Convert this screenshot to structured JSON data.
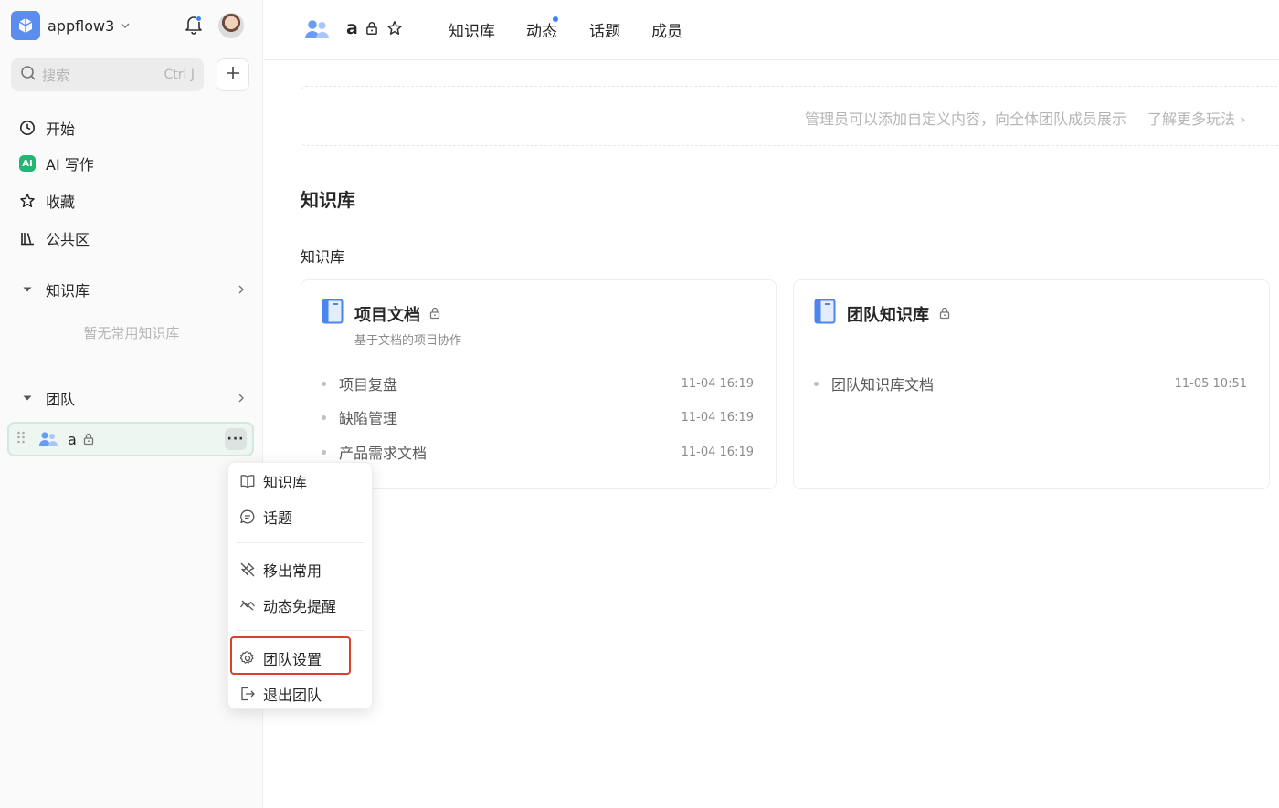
{
  "workspace": {
    "name": "appflow3"
  },
  "search": {
    "placeholder": "搜索",
    "shortcut": "Ctrl J"
  },
  "sidebar": {
    "nav": [
      {
        "label": "开始",
        "icon": "clock-icon"
      },
      {
        "label": "AI 写作",
        "icon": "ai-icon",
        "badge": "AI"
      },
      {
        "label": "收藏",
        "icon": "star-icon"
      },
      {
        "label": "公共区",
        "icon": "library-icon"
      }
    ],
    "knowledge_section": {
      "label": "知识库",
      "empty_text": "暂无常用知识库"
    },
    "team_section": {
      "label": "团队"
    },
    "team_item": {
      "name": "a",
      "more": "···"
    }
  },
  "context_menu": {
    "items": [
      {
        "label": "知识库",
        "icon": "book-icon"
      },
      {
        "label": "话题",
        "icon": "chat-icon"
      },
      {
        "label": "移出常用",
        "icon": "unpin-icon"
      },
      {
        "label": "动态免提醒",
        "icon": "mute-icon"
      },
      {
        "label": "团队设置",
        "icon": "gear-icon",
        "highlighted": true
      },
      {
        "label": "退出团队",
        "icon": "exit-icon"
      }
    ]
  },
  "header": {
    "team_name": "a",
    "tabs": [
      {
        "label": "知识库"
      },
      {
        "label": "动态",
        "has_dot": true
      },
      {
        "label": "话题"
      },
      {
        "label": "成员"
      }
    ]
  },
  "banner": {
    "text": "管理员可以添加自定义内容，向全体团队成员展示",
    "link": "了解更多玩法 ›"
  },
  "main": {
    "heading": "知识库",
    "subheading": "知识库",
    "cards": [
      {
        "title": "项目文档",
        "description": "基于文档的项目协作",
        "docs": [
          {
            "title": "项目复盘",
            "time": "11-04 16:19"
          },
          {
            "title": "缺陷管理",
            "time": "11-04 16:19"
          },
          {
            "title": "产品需求文档",
            "time": "11-04 16:19"
          }
        ]
      },
      {
        "title": "团队知识库",
        "description": "",
        "docs": [
          {
            "title": "团队知识库文档",
            "time": "11-05 10:51"
          }
        ]
      }
    ]
  },
  "colors": {
    "accent": "#3b82f6",
    "highlight_border": "#d9412f",
    "ai_badge": "#22b573"
  }
}
